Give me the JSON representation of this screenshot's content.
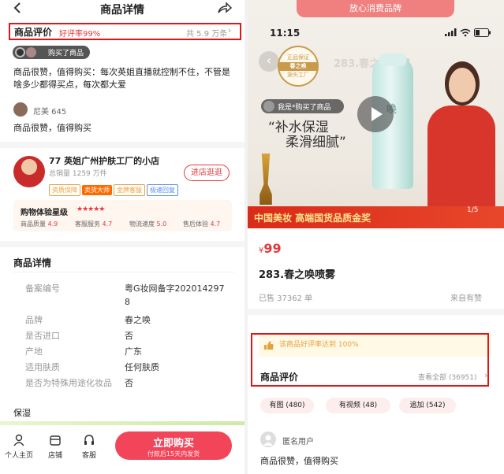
{
  "left": {
    "header": {
      "title": "商品详情"
    },
    "reviews": {
      "title": "商品评价",
      "rate": "好评率99%",
      "count": "共 5.9 万条"
    },
    "buyer_badge": "购买了商品",
    "review1": "商品很赞，值得购买：每次英姐直播就控制不住，不管是啥多少都得买点，每次都大爱",
    "reviewer": "尼美 645",
    "review2": "商品很赞，值得购买",
    "shop": {
      "name": "77 英姐广州护肤工厂的小店",
      "sales": "总销量 1259 万件",
      "tags": [
        "资质保障",
        "卖货大师",
        "金牌客服",
        "极速回复"
      ],
      "visit": "进店逛逛"
    },
    "rating": {
      "title": "购物体验星级",
      "stars": "★★★★★",
      "items": [
        {
          "label": "商品质量",
          "score": "4.9"
        },
        {
          "label": "客服服务",
          "score": "4.7"
        },
        {
          "label": "物流速度",
          "score": "5.0"
        },
        {
          "label": "售后体验",
          "score": "4.7"
        }
      ]
    },
    "details": {
      "title": "商品详情",
      "rows": [
        {
          "k": "备案编号",
          "v": "粤G妆网备字202014297"
        },
        {
          "k": "",
          "v": "8"
        },
        {
          "k": "品牌",
          "v": "春之唤"
        },
        {
          "k": "是否进口",
          "v": "否"
        },
        {
          "k": "产地",
          "v": "广东"
        },
        {
          "k": "适用肤质",
          "v": "任何肤质"
        },
        {
          "k": "是否为特殊用途化妆品",
          "v": "否"
        }
      ],
      "more": "保湿"
    },
    "bottom": {
      "tabs": [
        "个人主页",
        "店铺",
        "客服"
      ],
      "buy": "立即购买",
      "buy_sub": "付款后15天内发货"
    }
  },
  "right": {
    "top_banner": "放心消费品牌",
    "status_time": "11:15",
    "image": {
      "title": "283.春之唤喷雾",
      "badge": [
        "正品保证",
        "春之唤",
        "源头工厂"
      ],
      "buyer": "我是*购买了商品",
      "slogan1": "“补水保湿",
      "slogan2": "柔滑细腻”",
      "bottle": "唤",
      "footer": "中国美妆 高端国货品质金奖",
      "pager": "1/5"
    },
    "price": {
      "symbol": "¥",
      "value": "99"
    },
    "product_name": "283.春之唤喷雾",
    "sold": "已售 37362 单",
    "source": "来自有赞",
    "good_note": "该商品好评率达到 100%",
    "reviews": {
      "title": "商品评价",
      "view_all": "查看全部 (36951)"
    },
    "filters": [
      "有图 (480)",
      "有视频 (48)",
      "追加 (542)"
    ],
    "review_user": "匿名用户",
    "review_text": "商品很赞，值得购买"
  }
}
